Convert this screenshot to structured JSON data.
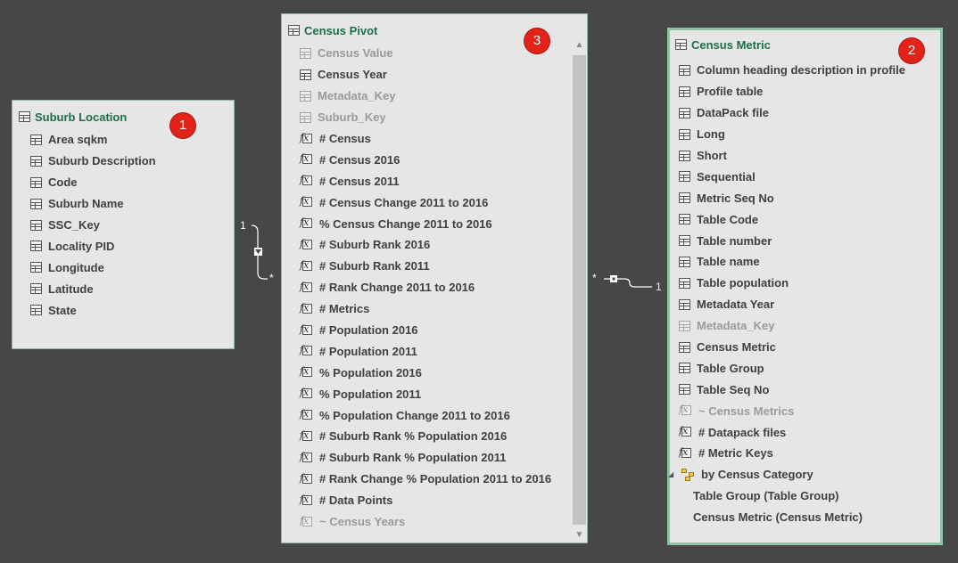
{
  "tables": {
    "suburb_location": {
      "title": "Suburb Location",
      "badge": "1",
      "fields": [
        {
          "label": "Area sqkm",
          "icon": "table-column-icon"
        },
        {
          "label": "Suburb Description",
          "icon": "table-column-icon"
        },
        {
          "label": "Code",
          "icon": "table-column-icon"
        },
        {
          "label": "Suburb Name",
          "icon": "table-column-icon"
        },
        {
          "label": "SSC_Key",
          "icon": "table-column-icon"
        },
        {
          "label": "Locality PID",
          "icon": "table-column-icon"
        },
        {
          "label": "Longitude",
          "icon": "table-column-icon"
        },
        {
          "label": "Latitude",
          "icon": "table-column-icon"
        },
        {
          "label": "State",
          "icon": "table-column-icon"
        }
      ]
    },
    "census_pivot": {
      "title": "Census Pivot",
      "badge": "3",
      "fields": [
        {
          "label": "Census Value",
          "icon": "table-column-icon",
          "hidden": true
        },
        {
          "label": "Census Year",
          "icon": "table-column-icon"
        },
        {
          "label": "Metadata_Key",
          "icon": "table-column-icon",
          "hidden": true
        },
        {
          "label": "Suburb_Key",
          "icon": "table-column-icon",
          "hidden": true
        },
        {
          "label": "# Census",
          "icon": "measure-icon"
        },
        {
          "label": "# Census 2016",
          "icon": "measure-icon"
        },
        {
          "label": "# Census 2011",
          "icon": "measure-icon"
        },
        {
          "label": "# Census Change 2011 to 2016",
          "icon": "measure-icon"
        },
        {
          "label": "% Census Change 2011 to 2016",
          "icon": "measure-icon"
        },
        {
          "label": "# Suburb Rank 2016",
          "icon": "measure-icon"
        },
        {
          "label": "# Suburb Rank 2011",
          "icon": "measure-icon"
        },
        {
          "label": "# Rank Change 2011 to 2016",
          "icon": "measure-icon"
        },
        {
          "label": "# Metrics",
          "icon": "measure-icon"
        },
        {
          "label": "# Population 2016",
          "icon": "measure-icon"
        },
        {
          "label": "# Population 2011",
          "icon": "measure-icon"
        },
        {
          "label": "% Population 2016",
          "icon": "measure-icon"
        },
        {
          "label": "% Population 2011",
          "icon": "measure-icon"
        },
        {
          "label": "% Population Change 2011 to 2016",
          "icon": "measure-icon"
        },
        {
          "label": "# Suburb Rank % Population 2016",
          "icon": "measure-icon"
        },
        {
          "label": "# Suburb Rank % Population 2011",
          "icon": "measure-icon"
        },
        {
          "label": "# Rank Change % Population 2011 to 2016",
          "icon": "measure-icon"
        },
        {
          "label": "# Data Points",
          "icon": "measure-icon"
        },
        {
          "label": "~ Census Years",
          "icon": "measure-icon",
          "hidden": true
        }
      ]
    },
    "census_metric": {
      "title": "Census Metric",
      "badge": "2",
      "fields": [
        {
          "label": "Column heading description in profile",
          "icon": "table-column-icon"
        },
        {
          "label": "Profile table",
          "icon": "table-column-icon"
        },
        {
          "label": "DataPack file",
          "icon": "table-column-icon"
        },
        {
          "label": "Long",
          "icon": "table-column-icon"
        },
        {
          "label": "Short",
          "icon": "table-column-icon"
        },
        {
          "label": "Sequential",
          "icon": "table-column-icon"
        },
        {
          "label": "Metric Seq No",
          "icon": "table-column-icon"
        },
        {
          "label": "Table Code",
          "icon": "table-column-icon"
        },
        {
          "label": "Table number",
          "icon": "table-column-icon"
        },
        {
          "label": "Table name",
          "icon": "table-column-icon"
        },
        {
          "label": "Table population",
          "icon": "table-column-icon"
        },
        {
          "label": "Metadata Year",
          "icon": "table-column-icon"
        },
        {
          "label": "Metadata_Key",
          "icon": "table-column-icon",
          "hidden": true
        },
        {
          "label": "Census Metric",
          "icon": "table-column-icon"
        },
        {
          "label": "Table Group",
          "icon": "table-column-icon"
        },
        {
          "label": "Table Seq No",
          "icon": "table-column-icon"
        },
        {
          "label": "~ Census Metrics",
          "icon": "measure-icon",
          "hidden": true
        },
        {
          "label": "# Datapack files",
          "icon": "measure-icon"
        },
        {
          "label": "# Metric Keys",
          "icon": "measure-icon"
        },
        {
          "label": "by Census Category",
          "icon": "hierarchy-icon",
          "expander": true
        },
        {
          "label": "Table Group  (Table Group)",
          "icon": "none",
          "indent": true
        },
        {
          "label": "Census Metric  (Census Metric)",
          "icon": "none",
          "indent": true
        }
      ]
    }
  },
  "relationships": {
    "left": {
      "one": "1",
      "many": "*"
    },
    "right": {
      "many": "*",
      "one": "1"
    }
  },
  "colors": {
    "canvas": "#474747",
    "card": "#e6e6e6",
    "title": "#1c6e4a",
    "badge": "#e2231a"
  }
}
